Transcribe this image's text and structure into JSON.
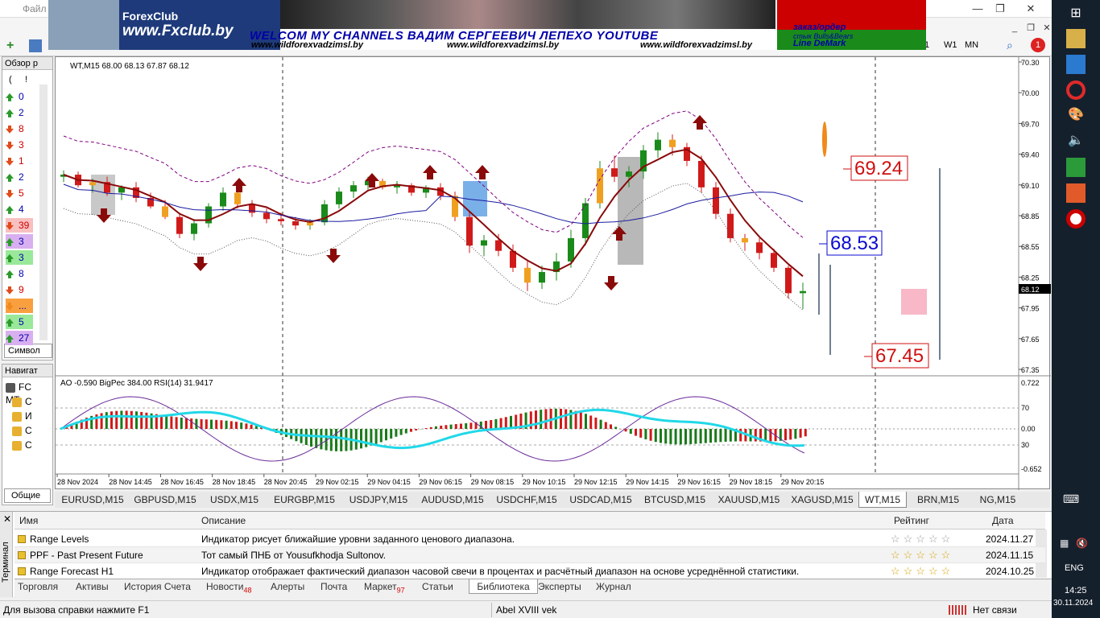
{
  "menu": {
    "file": "Файл"
  },
  "banner": {
    "logo_title": "ForexClub",
    "logo_url": "www.Fxclub.by",
    "main_text": "WELCOM MY CHANNELS ВАДИМ СЕРГЕЕВИЧ ЛЕПЕХО YOUTUBE",
    "site1": "www.wildforexvadzimsl.by",
    "site2": "www.wildforexvadzimsl.by",
    "site3": "www.wildforexvadzimsl.by",
    "order": "заказ/ордер",
    "order2": "стык Bulls&Bears",
    "order3": "Line DeMark"
  },
  "toolbar": {
    "timeframes": [
      "1",
      "W1",
      "MN"
    ],
    "notif_count": "1"
  },
  "market_watch": {
    "title": "Обзор р",
    "header": [
      "(",
      "!"
    ],
    "rows": [
      {
        "v": "0",
        "c": "green"
      },
      {
        "v": "2",
        "c": "green"
      },
      {
        "v": "8",
        "c": "red"
      },
      {
        "v": "3",
        "c": "red"
      },
      {
        "v": "1",
        "c": "red"
      },
      {
        "v": "2",
        "c": "green"
      },
      {
        "v": "5",
        "c": "red"
      },
      {
        "v": "4",
        "c": "green"
      },
      {
        "v": "39",
        "c": "red"
      },
      {
        "v": "3",
        "c": "green"
      },
      {
        "v": "3",
        "c": "green"
      },
      {
        "v": "8",
        "c": "green"
      },
      {
        "v": "9",
        "c": "red"
      },
      {
        "v": "...",
        "c": "orange"
      },
      {
        "v": "5",
        "c": "green"
      },
      {
        "v": "27",
        "c": "green"
      }
    ],
    "tab_label": "Символ"
  },
  "navigator": {
    "title": "Навигат",
    "items": [
      "FC MT",
      "С",
      "И",
      "С",
      "С"
    ],
    "tab_label": "Общие"
  },
  "chart": {
    "info_main": "WT,M15  68.00 68.13 67.87 68.12",
    "info_sub": "AO -0.590  BigPec 384.00  RSI(14) 31.9417",
    "price_labels": [
      "70.30",
      "70.00",
      "69.70",
      "69.40",
      "69.10",
      "68.85",
      "68.55",
      "68.25",
      "67.95",
      "67.65",
      "67.35"
    ],
    "current_price": "68.12",
    "sub_labels": [
      "0.722",
      "70",
      "0.00",
      "30",
      "-0.652"
    ],
    "time_labels": [
      "28 Nov 2024",
      "28 Nov 14:45",
      "28 Nov 16:45",
      "28 Nov 18:45",
      "28 Nov 20:45",
      "29 Nov 02:15",
      "29 Nov 04:15",
      "29 Nov 06:15",
      "29 Nov 08:15",
      "29 Nov 10:15",
      "29 Nov 12:15",
      "29 Nov 14:15",
      "29 Nov 16:15",
      "29 Nov 18:15",
      "29 Nov 20:15"
    ],
    "level_high": "69.24",
    "level_mid": "68.53",
    "level_low": "67.45"
  },
  "chart_data": {
    "type": "candlestick",
    "symbol": "WT,M15",
    "ylim": [
      67.35,
      70.3
    ],
    "candles": [
      [
        69.2,
        69.26,
        69.15,
        69.22
      ],
      [
        69.22,
        69.25,
        69.1,
        69.12
      ],
      [
        69.12,
        69.18,
        69.05,
        69.15
      ],
      [
        69.15,
        69.2,
        69.02,
        69.05
      ],
      [
        69.05,
        69.12,
        68.98,
        69.1
      ],
      [
        69.1,
        69.15,
        68.96,
        69.0
      ],
      [
        69.0,
        69.05,
        68.9,
        68.92
      ],
      [
        68.92,
        68.98,
        68.8,
        68.82
      ],
      [
        68.82,
        68.86,
        68.62,
        68.66
      ],
      [
        68.66,
        68.8,
        68.6,
        68.76
      ],
      [
        68.76,
        68.95,
        68.72,
        68.92
      ],
      [
        68.92,
        69.1,
        68.88,
        69.05
      ],
      [
        69.05,
        69.08,
        68.9,
        68.94
      ],
      [
        68.94,
        68.98,
        68.82,
        68.86
      ],
      [
        68.86,
        68.9,
        68.76,
        68.8
      ],
      [
        68.8,
        68.86,
        68.74,
        68.78
      ],
      [
        68.78,
        68.82,
        68.7,
        68.74
      ],
      [
        68.74,
        68.8,
        68.7,
        68.77
      ],
      [
        68.77,
        68.98,
        68.74,
        68.94
      ],
      [
        68.94,
        69.1,
        68.9,
        69.06
      ],
      [
        69.06,
        69.16,
        69.0,
        69.12
      ],
      [
        69.12,
        69.2,
        69.08,
        69.16
      ],
      [
        69.16,
        69.18,
        69.08,
        69.1
      ],
      [
        69.1,
        69.16,
        69.04,
        69.12
      ],
      [
        69.12,
        69.14,
        69.02,
        69.05
      ],
      [
        69.05,
        69.12,
        69.0,
        69.1
      ],
      [
        69.1,
        69.14,
        68.98,
        69.02
      ],
      [
        69.02,
        69.06,
        68.78,
        68.82
      ],
      [
        68.82,
        68.88,
        68.48,
        68.55
      ],
      [
        68.55,
        68.65,
        68.45,
        68.6
      ],
      [
        68.6,
        68.66,
        68.45,
        68.5
      ],
      [
        68.5,
        68.56,
        68.3,
        68.34
      ],
      [
        68.34,
        68.4,
        68.12,
        68.2
      ],
      [
        68.2,
        68.36,
        68.14,
        68.3
      ],
      [
        68.3,
        68.48,
        68.22,
        68.4
      ],
      [
        68.4,
        68.7,
        68.34,
        68.62
      ],
      [
        68.62,
        69.0,
        68.55,
        68.95
      ],
      [
        68.95,
        69.35,
        68.9,
        69.28
      ],
      [
        69.28,
        69.4,
        69.15,
        69.2
      ],
      [
        69.2,
        69.3,
        69.1,
        69.25
      ],
      [
        69.25,
        69.5,
        69.18,
        69.45
      ],
      [
        69.45,
        69.62,
        69.38,
        69.55
      ],
      [
        69.55,
        69.6,
        69.4,
        69.48
      ],
      [
        69.48,
        69.52,
        69.3,
        69.35
      ],
      [
        69.35,
        69.4,
        69.05,
        69.1
      ],
      [
        69.1,
        69.15,
        68.8,
        68.85
      ],
      [
        68.85,
        68.9,
        68.58,
        68.62
      ],
      [
        68.62,
        68.66,
        68.5,
        68.58
      ],
      [
        68.58,
        68.62,
        68.42,
        68.48
      ],
      [
        68.48,
        68.52,
        68.3,
        68.34
      ],
      [
        68.34,
        68.36,
        68.05,
        68.1
      ],
      [
        68.1,
        68.2,
        67.95,
        68.12
      ]
    ],
    "levels": [
      69.24,
      68.53,
      67.45
    ]
  },
  "symbol_tabs": [
    "EURUSD,M15",
    "GBPUSD,M15",
    "USDX,M15",
    "EURGBP,M15",
    "USDJPY,M15",
    "AUDUSD,M15",
    "USDCHF,M15",
    "USDCAD,M15",
    "BTCUSD,M15",
    "XAUUSD,M15",
    "XAGUSD,M15",
    "WT,M15",
    "BRN,M15",
    "NG,M15"
  ],
  "terminal": {
    "side_label": "Терминал",
    "headers": {
      "name": "Имя",
      "desc": "Описание",
      "rating": "Рейтинг",
      "date": "Дата"
    },
    "rows": [
      {
        "name": "Range Levels",
        "desc": "Индикатор рисует ближайшие уровни заданного ценового диапазона.",
        "date": "2024.11.27",
        "stars": 0
      },
      {
        "name": "PPF - Past Present Future",
        "desc": "Тот самый ПНБ от Yousufkhodja Sultonov.",
        "date": "2024.11.15",
        "stars": 5
      },
      {
        "name": "Range Forecast H1",
        "desc": "Индикатор отображает фактический диапазон часовой свечи в процентах и расчётный диапазон на основе усреднённой статистики.",
        "date": "2024.10.25",
        "stars": 5
      }
    ],
    "tabs": [
      {
        "label": "Торговля",
        "badge": ""
      },
      {
        "label": "Активы",
        "badge": ""
      },
      {
        "label": "История Счета",
        "badge": ""
      },
      {
        "label": "Новости",
        "badge": "48"
      },
      {
        "label": "Алерты",
        "badge": ""
      },
      {
        "label": "Почта",
        "badge": ""
      },
      {
        "label": "Маркет",
        "badge": "97"
      },
      {
        "label": "Статьи",
        "badge": ""
      },
      {
        "label": "Библиотека",
        "badge": ""
      },
      {
        "label": "Эксперты",
        "badge": ""
      },
      {
        "label": "Журнал",
        "badge": ""
      }
    ]
  },
  "status": {
    "help": "Для вызова справки нажмите F1",
    "profile": "Abel XVIII vek",
    "connection": "Нет связи"
  },
  "taskbar": {
    "lang": "ENG",
    "time": "14:25",
    "date": "30.11.2024"
  }
}
